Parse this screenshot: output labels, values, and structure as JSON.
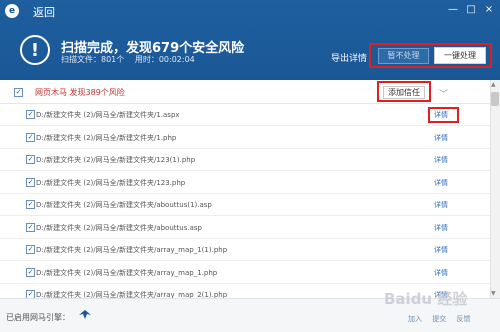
{
  "header": {
    "app_logo": "e",
    "back_label": "返回",
    "scan_title": "扫描完成，发现679个安全风险",
    "scanned_label": "扫描文件：801个",
    "elapsed_label": "用时：00:02:04",
    "export_label": "导出详情",
    "ignore_label": "暂不处理",
    "fix_all_label": "一键处理",
    "window_buttons": [
      "—",
      "□",
      "×"
    ]
  },
  "group": {
    "title": "网页木马  发现389个风险",
    "trust_label": "添加信任",
    "collapse_glyph": "﹀"
  },
  "rows": [
    {
      "path": "D:/新建文件夹 (2)/网马全/新建文件夹/1.aspx",
      "detail": "详情"
    },
    {
      "path": "D:/新建文件夹 (2)/网马全/新建文件夹/1.php",
      "detail": "详情"
    },
    {
      "path": "D:/新建文件夹 (2)/网马全/新建文件夹/123(1).php",
      "detail": "详情"
    },
    {
      "path": "D:/新建文件夹 (2)/网马全/新建文件夹/123.php",
      "detail": "详情"
    },
    {
      "path": "D:/新建文件夹 (2)/网马全/新建文件夹/abouttus(1).asp",
      "detail": "详情"
    },
    {
      "path": "D:/新建文件夹 (2)/网马全/新建文件夹/abouttus.asp",
      "detail": "详情"
    },
    {
      "path": "D:/新建文件夹 (2)/网马全/新建文件夹/array_map_1(1).php",
      "detail": "详情"
    },
    {
      "path": "D:/新建文件夹 (2)/网马全/新建文件夹/array_map_1.php",
      "detail": "详情"
    },
    {
      "path": "D:/新建文件夹 (2)/网马全/新建文件夹/array_map_2(1).php",
      "detail": "详情"
    }
  ],
  "footer": {
    "engine_label": "已启用网马引擎：",
    "links": [
      "加入",
      "提交",
      "反馈"
    ],
    "watermark": "Baidu 经验"
  },
  "colors": {
    "header_bg": "#1a5796",
    "highlight": "#e02020",
    "link": "#2a6cc4",
    "risk_text": "#c03030"
  }
}
